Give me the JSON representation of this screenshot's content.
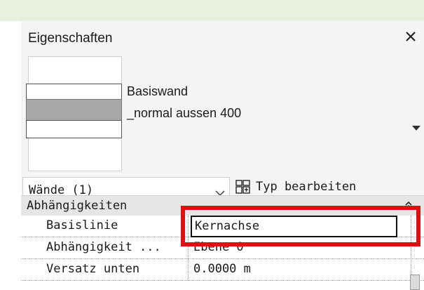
{
  "panel": {
    "title": "Eigenschaften",
    "close_icon": "close-icon"
  },
  "type_selector": {
    "family": "Basiswand",
    "type_name": "_normal aussen 400",
    "dropdown_icon": "triangle-down-icon"
  },
  "filter": {
    "selected": "Wände (1)",
    "edit_type_label": "Typ bearbeiten",
    "edit_type_icon": "edit-type-icon"
  },
  "group": {
    "label": "Abhängigkeiten",
    "collapse_icon": "collapse-up-icon"
  },
  "properties": [
    {
      "label": "Basislinie",
      "value": "Kernachse"
    },
    {
      "label": "Abhängigkeit ...",
      "value": "Ebene 0"
    },
    {
      "label": "Versatz unten",
      "value": "0.0000 m"
    }
  ],
  "colors": {
    "highlight": "#e01010",
    "top_band": "#e8f1e0"
  }
}
